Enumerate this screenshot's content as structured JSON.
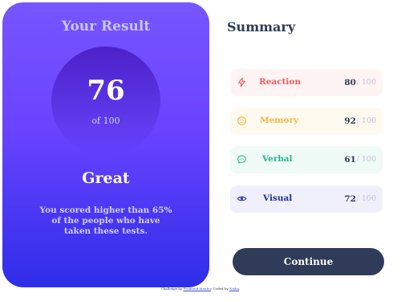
{
  "result": {
    "title": "Your Result",
    "score": "76",
    "out_of": "of 100",
    "grade": "Great",
    "description": "You scored higher than 65% of the people who have taken these tests."
  },
  "summary": {
    "title": "Summary",
    "items": [
      {
        "label": "Reaction",
        "score": "80",
        "max": "/ 100",
        "color": "#f05a5a",
        "bg": "#fff4f4",
        "icon": "lightning-icon"
      },
      {
        "label": "Memory",
        "score": "92",
        "max": "/ 100",
        "color": "#f5b53a",
        "bg": "#fffaf0",
        "icon": "brain-icon"
      },
      {
        "label": "Verbal",
        "score": "61",
        "max": "/ 100",
        "color": "#22b78e",
        "bg": "#f0faf7",
        "icon": "chat-icon"
      },
      {
        "label": "Visual",
        "score": "72",
        "max": "/ 100",
        "color": "#1e2b9e",
        "bg": "#f0f0fd",
        "icon": "eye-icon"
      }
    ]
  },
  "actions": {
    "continue_label": "Continue"
  },
  "attribution": {
    "prefix": "Challenge by",
    "challenge_link": "Frontend Mentor",
    "middle": ". Coded by",
    "author_link": "Nadia",
    "suffix": "."
  }
}
